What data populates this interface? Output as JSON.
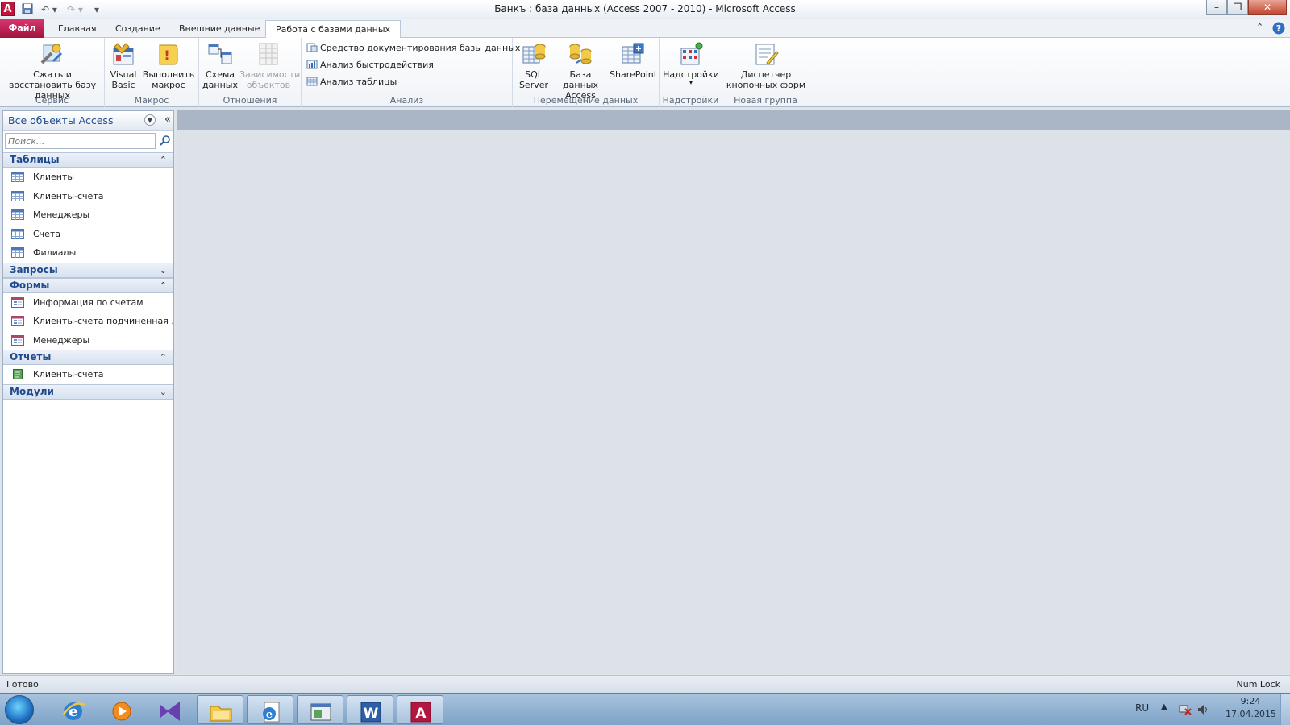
{
  "titlebar": {
    "app_logo": "A",
    "title": "Банкъ : база данных (Access 2007 - 2010)  -  Microsoft Access"
  },
  "tabs": [
    {
      "label": "Файл"
    },
    {
      "label": "Главная"
    },
    {
      "label": "Создание"
    },
    {
      "label": "Внешние данные"
    },
    {
      "label": "Работа с базами данных",
      "active": true
    }
  ],
  "ribbon": {
    "groups": {
      "service": {
        "label": "Сервис",
        "compact": "Сжать и восстановить базу данных"
      },
      "macro": {
        "label": "Макрос",
        "vb": "Visual Basic",
        "run": "Выполнить макрос"
      },
      "relations": {
        "label": "Отношения",
        "schema": "Схема данных",
        "deps": "Зависимости объектов"
      },
      "analysis": {
        "label": "Анализ",
        "doc": "Средство документирования базы данных",
        "perf": "Анализ быстродействия",
        "table": "Анализ таблицы"
      },
      "move": {
        "label": "Перемещение данных",
        "sql": "SQL Server",
        "access": "База данных Access",
        "sharepoint": "SharePoint"
      },
      "addins": {
        "label": "Надстройки",
        "btn": "Надстройки"
      },
      "newgroup": {
        "label": "Новая группа",
        "btn": "Диспетчер кнопочных форм"
      }
    }
  },
  "nav": {
    "title": "Все объекты Access",
    "search_placeholder": "Поиск...",
    "sections": {
      "tables": {
        "label": "Таблицы",
        "items": [
          "Клиенты",
          "Клиенты-счета",
          "Менеджеры",
          "Счета",
          "Филиалы"
        ]
      },
      "queries": {
        "label": "Запросы"
      },
      "forms": {
        "label": "Формы",
        "items": [
          "Информация по счетам",
          "Клиенты-счета подчиненная ...",
          "Менеджеры"
        ]
      },
      "reports": {
        "label": "Отчеты",
        "items": [
          "Клиенты-счета"
        ]
      },
      "modules": {
        "label": "Модули"
      }
    }
  },
  "statusbar": {
    "status": "Готово",
    "numlock": "Num Lock"
  },
  "taskbar": {
    "lang": "RU",
    "time": "9:24",
    "date": "17.04.2015"
  },
  "colors": {
    "file_tab": "#c0163c",
    "nav_title": "#1f4b8e",
    "workspace": "#dde2e9"
  }
}
